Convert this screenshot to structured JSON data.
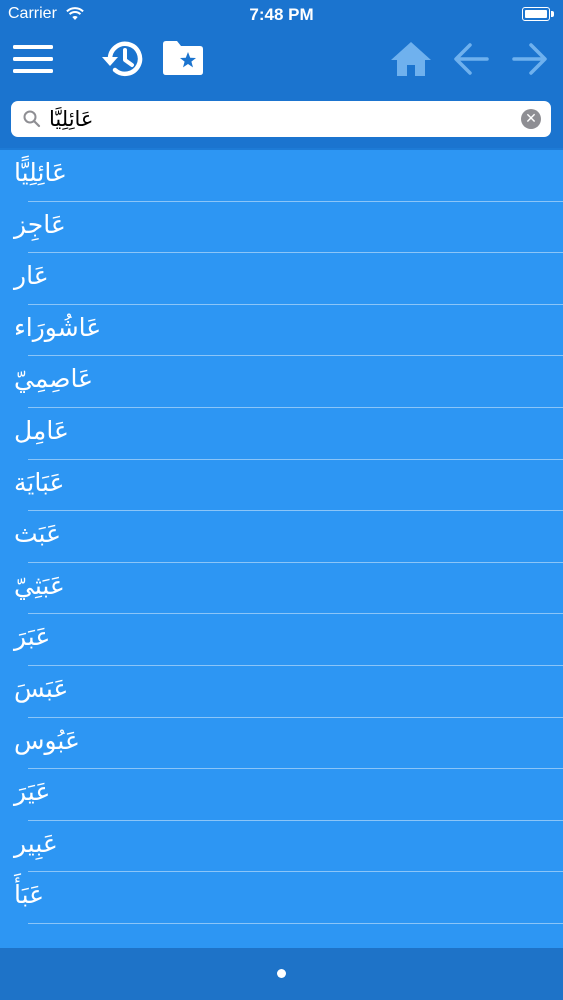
{
  "status_bar": {
    "carrier": "Carrier",
    "time": "7:48 PM"
  },
  "toolbar": {
    "icons": [
      "menu-icon",
      "history-icon",
      "favorites-folder-icon",
      "home-icon",
      "back-arrow-icon",
      "forward-arrow-icon"
    ],
    "colors": {
      "bar": "#1b74cf",
      "active_icon": "#ffffff",
      "inactive_icon": "#6fb1ee"
    }
  },
  "search": {
    "value": "عَائِلِيًّا"
  },
  "list": {
    "items": [
      "عَائِلِيًّا",
      "عَاجِز",
      "عَار",
      "عَاشُورَاء",
      "عَاصِمِيّ",
      "عَامِل",
      "عَبَايَة",
      "عَبَث",
      "عَبَثِيّ",
      "عَبَرَ",
      "عَبَسَ",
      "عَبُوس",
      "عَيَرَ",
      "عَبِير",
      "عَبَأَ"
    ],
    "colors": {
      "background": "#2d96f3",
      "text": "#ffffff"
    }
  },
  "pager": {
    "current_page": 1,
    "total_pages": 1
  }
}
